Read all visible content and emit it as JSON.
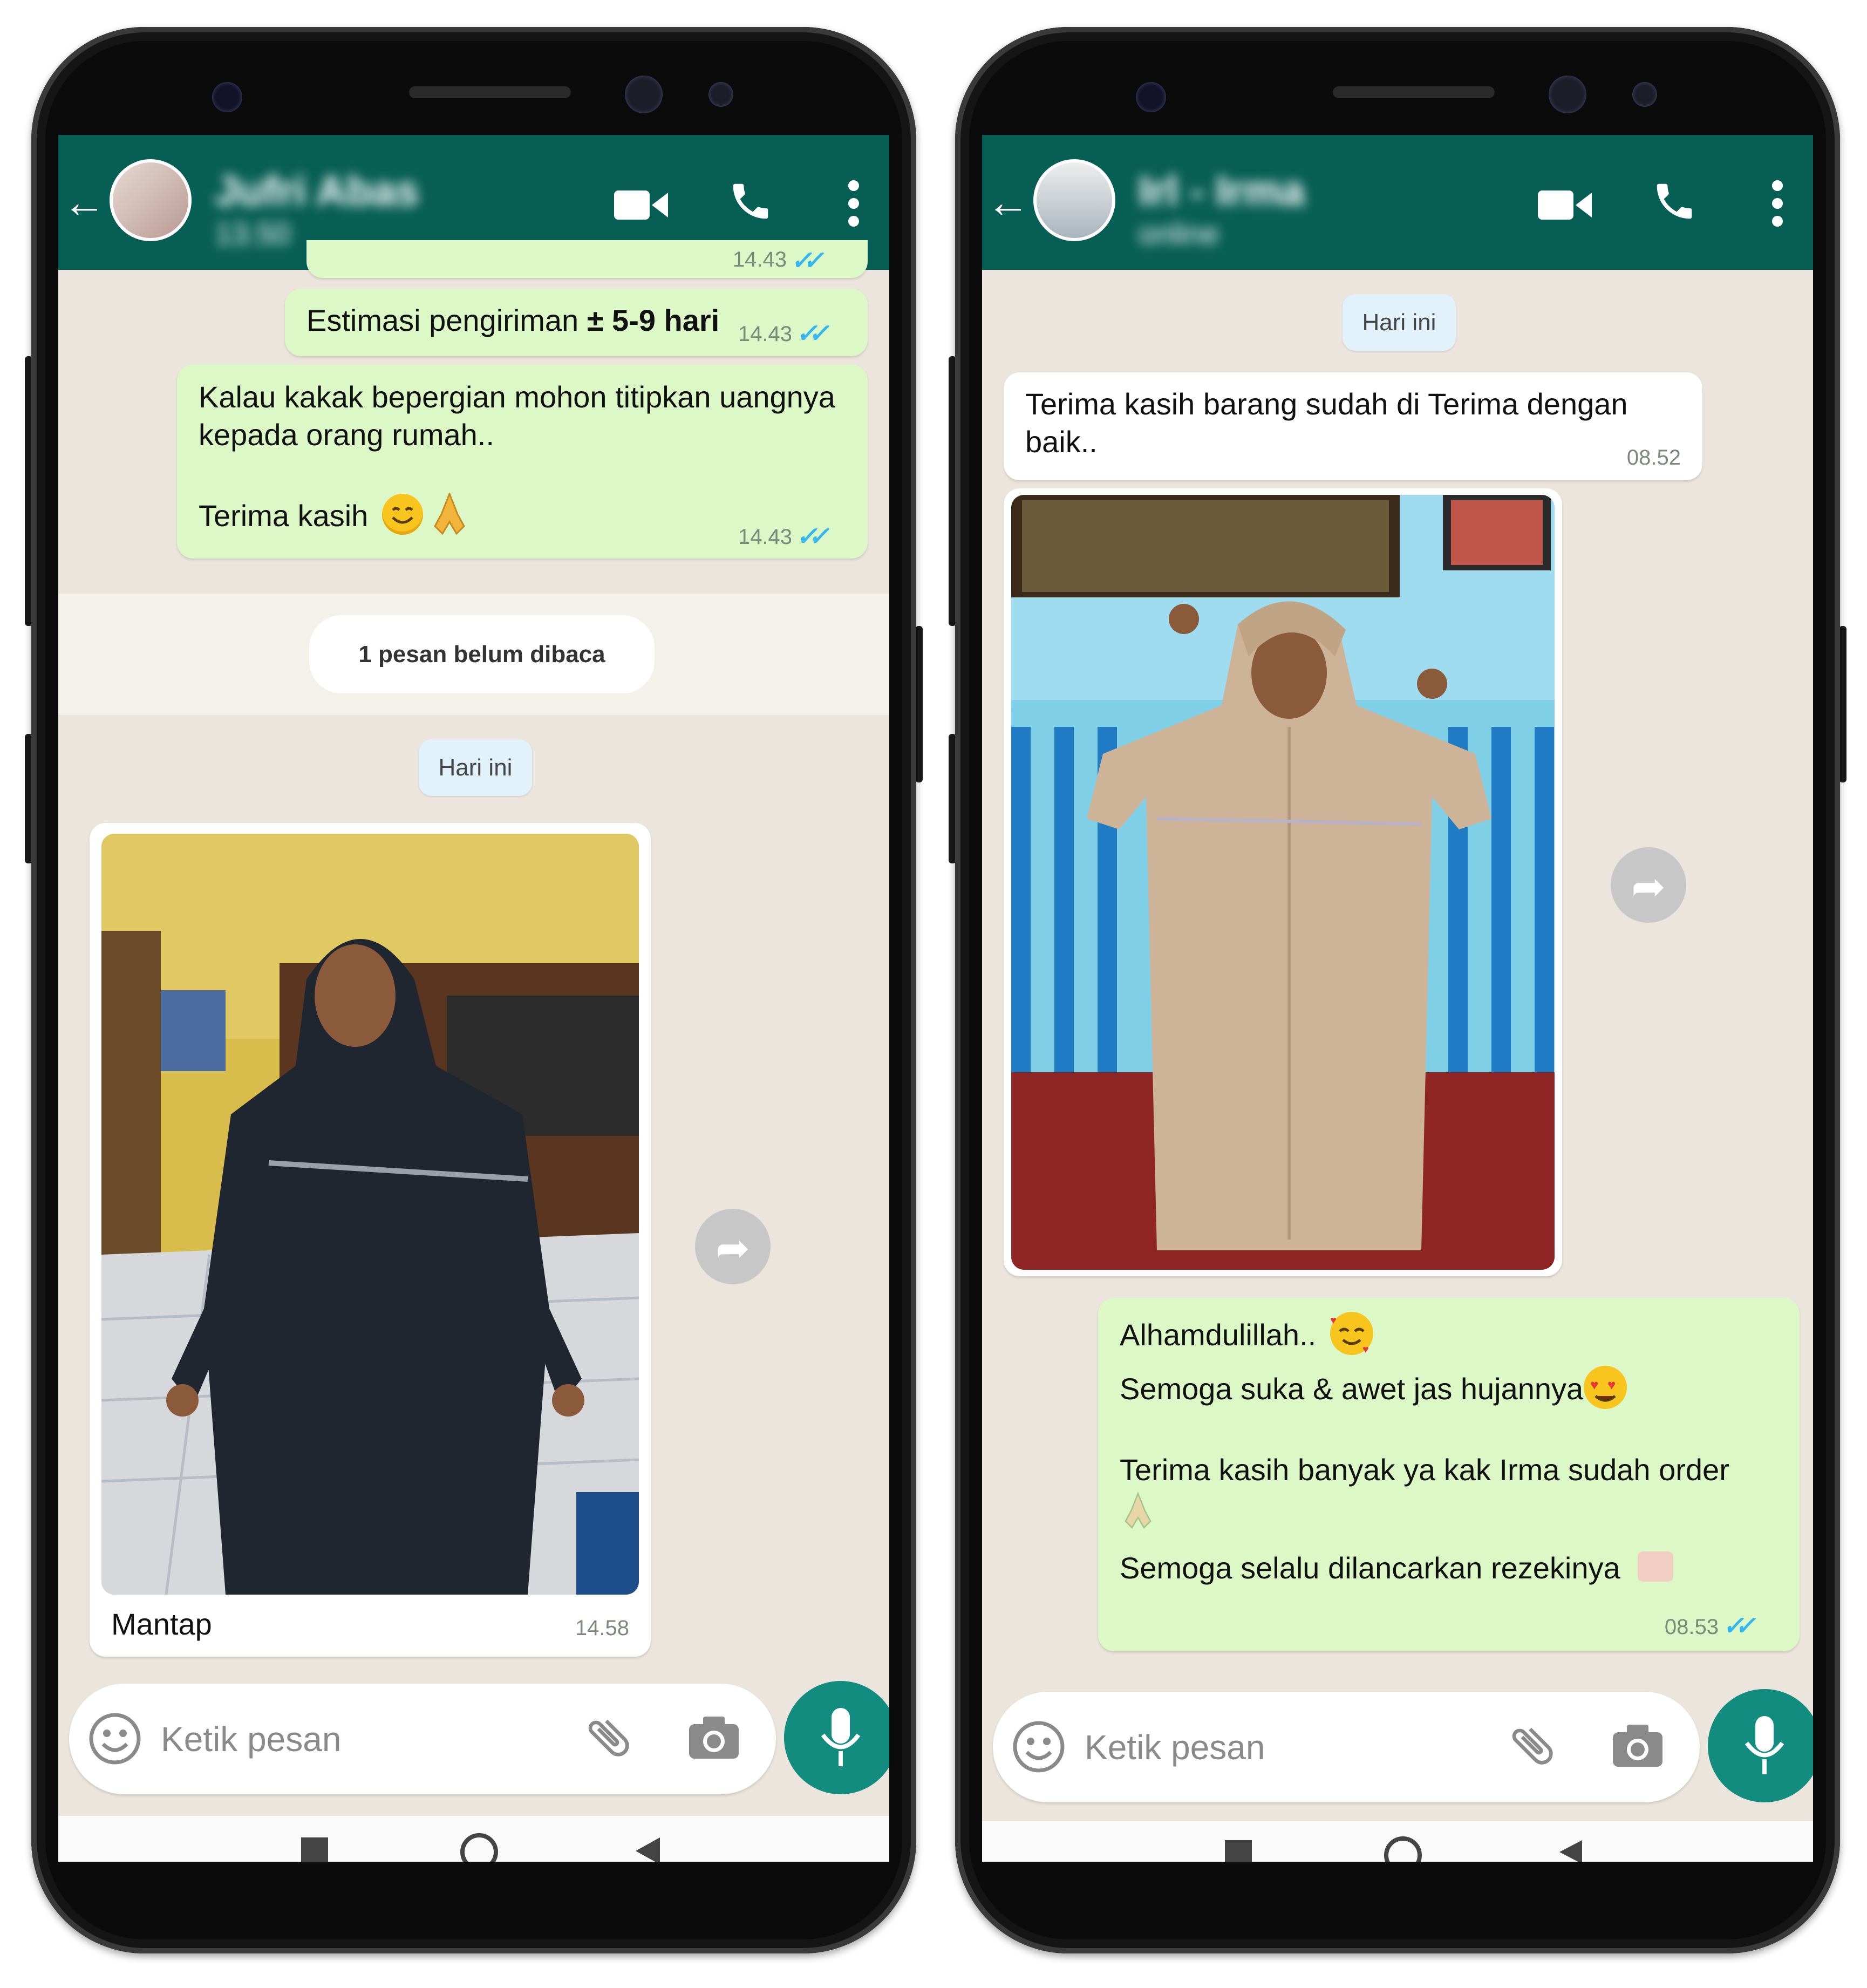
{
  "colors": {
    "header": "#075e54",
    "outgoing_bubble": "#dcf8c6",
    "incoming_bubble": "#ffffff",
    "chat_bg": "#ece5dd",
    "read_ticks": "#34b7f1",
    "mic": "#128c7e"
  },
  "phone_left": {
    "header": {
      "contact_name": "Jufri Abas",
      "status": "13.50"
    },
    "top_partial_time": "14.43",
    "messages": [
      {
        "text_plain": "Estimasi pengiriman ",
        "text_bold": "± 5-9 hari",
        "time": "14.43"
      },
      {
        "line1": "Kalau kakak bepergian mohon titipkan uangnya",
        "line2": "kepada orang rumah..",
        "line3": "Terima kasih",
        "time": "14.43"
      }
    ],
    "unread_label": "1 pesan belum dibaca",
    "date_chip": "Hari ini",
    "image_message": {
      "caption": "Mantap",
      "time": "14.58"
    },
    "input_placeholder": "Ketik pesan",
    "icons": {
      "back": "back-arrow-icon",
      "video": "video-call-icon",
      "call": "phone-icon",
      "menu": "more-vert-icon",
      "emoji": "emoji-icon",
      "attach": "paperclip-icon",
      "camera": "camera-icon",
      "mic": "microphone-icon",
      "forward": "forward-icon"
    }
  },
  "phone_right": {
    "header": {
      "contact_name": "Irl - Irma",
      "status": "online"
    },
    "date_chip": "Hari ini",
    "incoming": {
      "line1": "Terima kasih barang sudah di Terima dengan",
      "line2": "baik..",
      "time": "08.52"
    },
    "reply": {
      "line1": "Alhamdulillah..",
      "line2": "Semoga suka & awet jas hujannya",
      "line3": "Terima kasih banyak ya kak Irma sudah order",
      "line4": "Semoga selalu dilancarkan rezekinya",
      "time": "08.53"
    },
    "input_placeholder": "Ketik pesan"
  }
}
